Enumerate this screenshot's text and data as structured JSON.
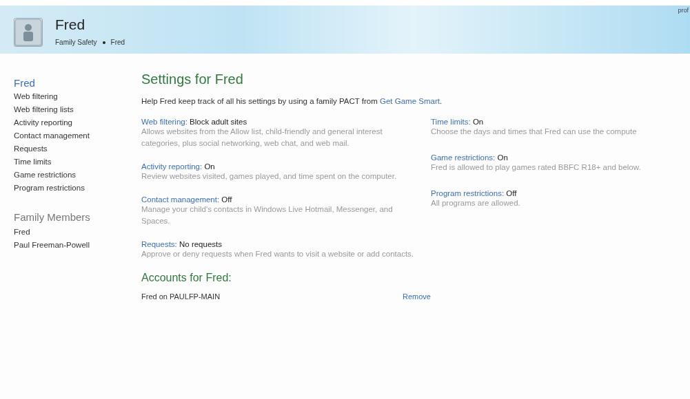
{
  "header": {
    "title": "Fred",
    "breadcrumb": [
      "Family Safety",
      "Fred"
    ],
    "corner_text": "prof"
  },
  "sidebar": {
    "items": [
      {
        "label": "Fred",
        "selected": true
      },
      {
        "label": "Web filtering",
        "selected": false
      },
      {
        "label": "Web filtering lists",
        "selected": false
      },
      {
        "label": "Activity reporting",
        "selected": false
      },
      {
        "label": "Contact management",
        "selected": false
      },
      {
        "label": "Requests",
        "selected": false
      },
      {
        "label": "Time limits",
        "selected": false
      },
      {
        "label": "Game restrictions",
        "selected": false
      },
      {
        "label": "Program restrictions",
        "selected": false
      }
    ],
    "members_title": "Family Members",
    "members": [
      "Fred",
      "Paul Freeman-Powell"
    ]
  },
  "main": {
    "title": "Settings for Fred",
    "intro": "Help Fred keep track of all his settings by using a family PACT from ",
    "intro_link": "Get Game Smart",
    "intro_end": ".",
    "left_settings": [
      {
        "label": "Web filtering:",
        "value": "Block adult sites",
        "description": "Allows websites from the Allow list, child-friendly and general interest categories, plus social networking, web chat, and web mail."
      },
      {
        "label": "Activity reporting:",
        "value": "On",
        "description": "Review websites visited, games played, and time spent on the computer."
      },
      {
        "label": "Contact management:",
        "value": "Off",
        "description": "Manage your child's contacts in Windows Live Hotmail, Messenger, and Spaces."
      },
      {
        "label": "Requests:",
        "value": "No requests",
        "description": "Approve or deny requests when Fred wants to visit a website or add contacts."
      }
    ],
    "right_settings": [
      {
        "label": "Time limits:",
        "value": "On",
        "description": "Choose the days and times that Fred can use the compute"
      },
      {
        "label": "Game restrictions:",
        "value": "On",
        "description": "Fred is allowed to play games rated BBFC R18+ and below."
      },
      {
        "label": "Program restrictions:",
        "value": "Off",
        "description": "All programs are allowed."
      }
    ],
    "accounts_title": "Accounts for Fred:",
    "accounts": [
      {
        "name": "Fred on PAULFP-MAIN",
        "action": "Remove"
      }
    ]
  }
}
